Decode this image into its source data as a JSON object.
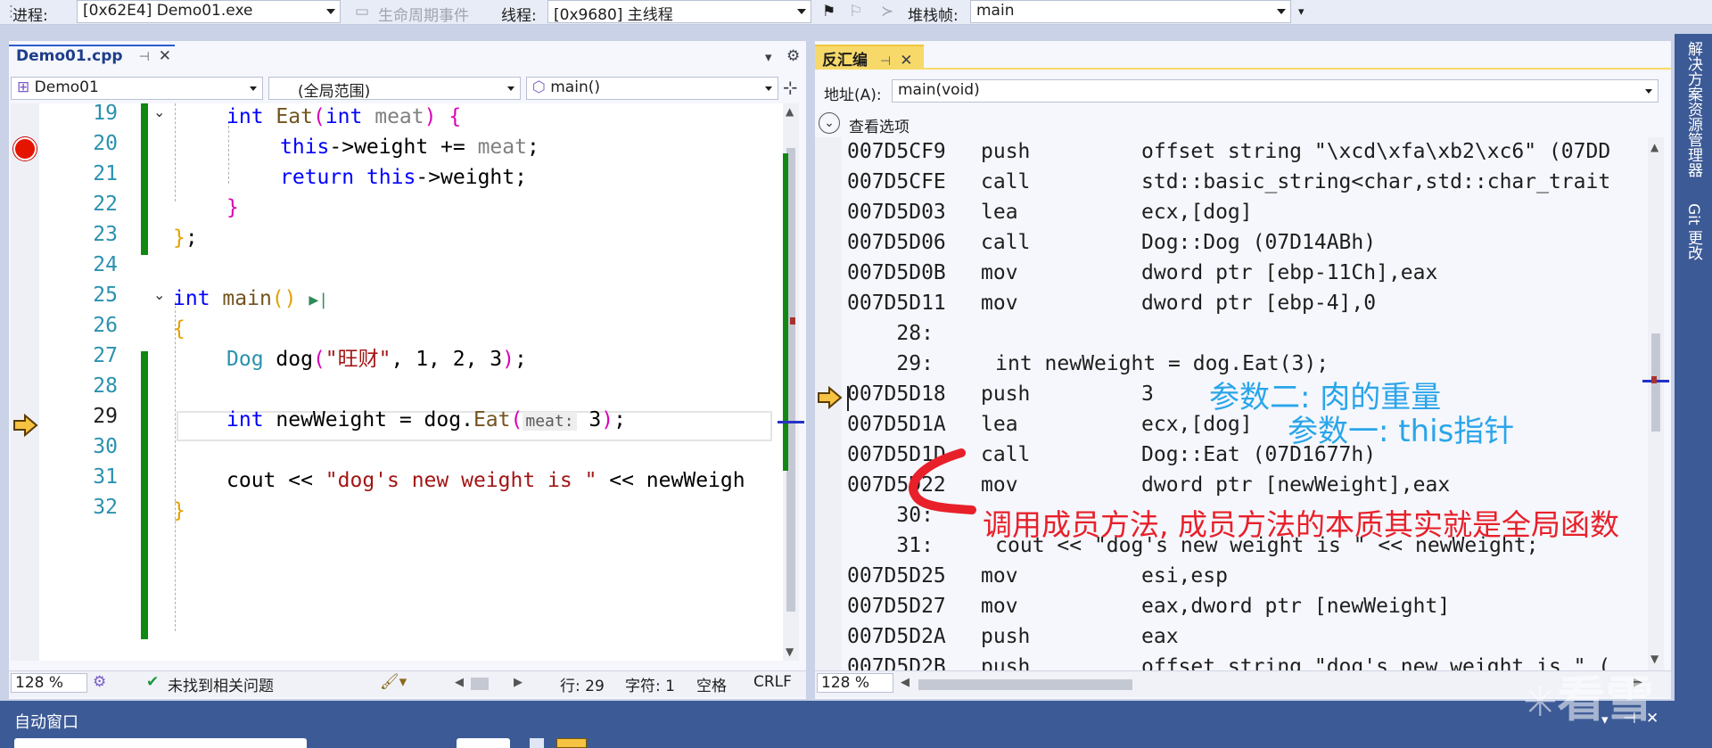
{
  "toolbar": {
    "process_label": "进程:",
    "process_value": "[0x62E4] Demo01.exe",
    "lifecycle_label": "生命周期事件",
    "thread_label": "线程:",
    "thread_value": "[0x9680] 主线程",
    "stackframe_label": "堆栈帧:",
    "stackframe_value": "main"
  },
  "editor": {
    "tab_title": "Demo01.cpp",
    "nav_project": "Demo01",
    "nav_scope": "(全局范围)",
    "nav_member": "main()",
    "zoom": "128 %",
    "issues": "未找到相关问题",
    "line_pos": "行: 29",
    "col_pos": "字符: 1",
    "whitespace": "空格",
    "line_ending": "CRLF",
    "line_numbers": [
      "19",
      "20",
      "21",
      "22",
      "23",
      "24",
      "25",
      "26",
      "27",
      "28",
      "29",
      "30",
      "31",
      "32"
    ]
  },
  "disassembly": {
    "tab_title": "反汇编",
    "address_label": "地址(A):",
    "address_value": "main(void)",
    "view_options": "查看选项",
    "zoom": "128 %",
    "rows": [
      {
        "addr": "007D5CF9",
        "op": "push",
        "args": "offset string \"\\xcd\\xfa\\xb2\\xc6\" (07DD"
      },
      {
        "addr": "007D5CFE",
        "op": "call",
        "args": "std::basic_string<char,std::char_trait"
      },
      {
        "addr": "007D5D03",
        "op": "lea",
        "args": "ecx,[dog]"
      },
      {
        "addr": "007D5D06",
        "op": "call",
        "args": "Dog::Dog (07D14ABh)"
      },
      {
        "addr": "007D5D0B",
        "op": "mov",
        "args": "dword ptr [ebp-11Ch],eax"
      },
      {
        "addr": "007D5D11",
        "op": "mov",
        "args": "dword ptr [ebp-4],0"
      },
      {
        "src": "    28:"
      },
      {
        "src": "    29:     int newWeight = dog.Eat(3);"
      },
      {
        "addr": "007D5D18",
        "op": "push",
        "args": "3"
      },
      {
        "addr": "007D5D1A",
        "op": "lea",
        "args": "ecx,[dog]"
      },
      {
        "addr": "007D5D1D",
        "op": "call",
        "args": "Dog::Eat (07D1677h)"
      },
      {
        "addr": "007D5D22",
        "op": "mov",
        "args": "dword ptr [newWeight],eax"
      },
      {
        "src": "    30:"
      },
      {
        "src": "    31:     cout << \"dog's new weight is \" << newWeight;"
      },
      {
        "addr": "007D5D25",
        "op": "mov",
        "args": "esi,esp"
      },
      {
        "addr": "007D5D27",
        "op": "mov",
        "args": "eax,dword ptr [newWeight]"
      },
      {
        "addr": "007D5D2A",
        "op": "push",
        "args": "eax"
      },
      {
        "addr": "007D5D2B",
        "op": "push",
        "args": "offset string \"dog's new weight is \" ("
      }
    ]
  },
  "annotations": {
    "param2": "参数二: 肉的重量",
    "param1": "参数一: this指针",
    "call_note": "调用成员方法, 成员方法的本质其实就是全局函数"
  },
  "side_tabs": {
    "solution_explorer": "解决方案资源管理器",
    "git_changes": "Git 更改"
  },
  "bottom": {
    "auto_window": "自动窗口"
  },
  "watermark": "看雪",
  "colors": {
    "annotation_blue": "#2aa5ea",
    "annotation_red": "#e8202a",
    "change_bar_green": "#118811",
    "breakpoint_red": "#e51400",
    "current_line_yellow": "#f5c242"
  }
}
